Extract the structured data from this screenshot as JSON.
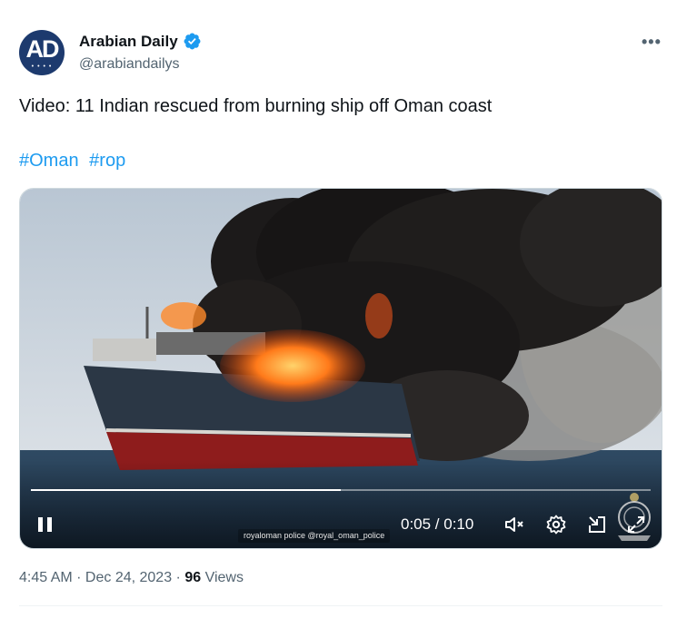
{
  "author": {
    "avatar_text": "AD",
    "display_name": "Arabian Daily",
    "handle": "@arabiandailys",
    "verified": true,
    "more_label": "•••"
  },
  "tweet": {
    "text": "Video: 11 Indian rescued from burning ship off Oman coast",
    "hashtags": [
      "#Oman",
      "#rop"
    ]
  },
  "video": {
    "time_display": "0:05 / 0:10",
    "progress_fraction": 0.5,
    "watermark": "royaloman police  @royal_oman_police",
    "icons": [
      "pause-icon",
      "volume-muted-icon",
      "settings-gear-icon",
      "popout-icon",
      "fullscreen-icon"
    ]
  },
  "meta": {
    "time": "4:45 AM",
    "sep1": " · ",
    "date": "Dec 24, 2023",
    "sep2": " · ",
    "views_count": "96",
    "views_label": " Views"
  },
  "colors": {
    "link": "#1d9bf0",
    "verified": "#1d9bf0",
    "secondary_text": "#536471"
  }
}
